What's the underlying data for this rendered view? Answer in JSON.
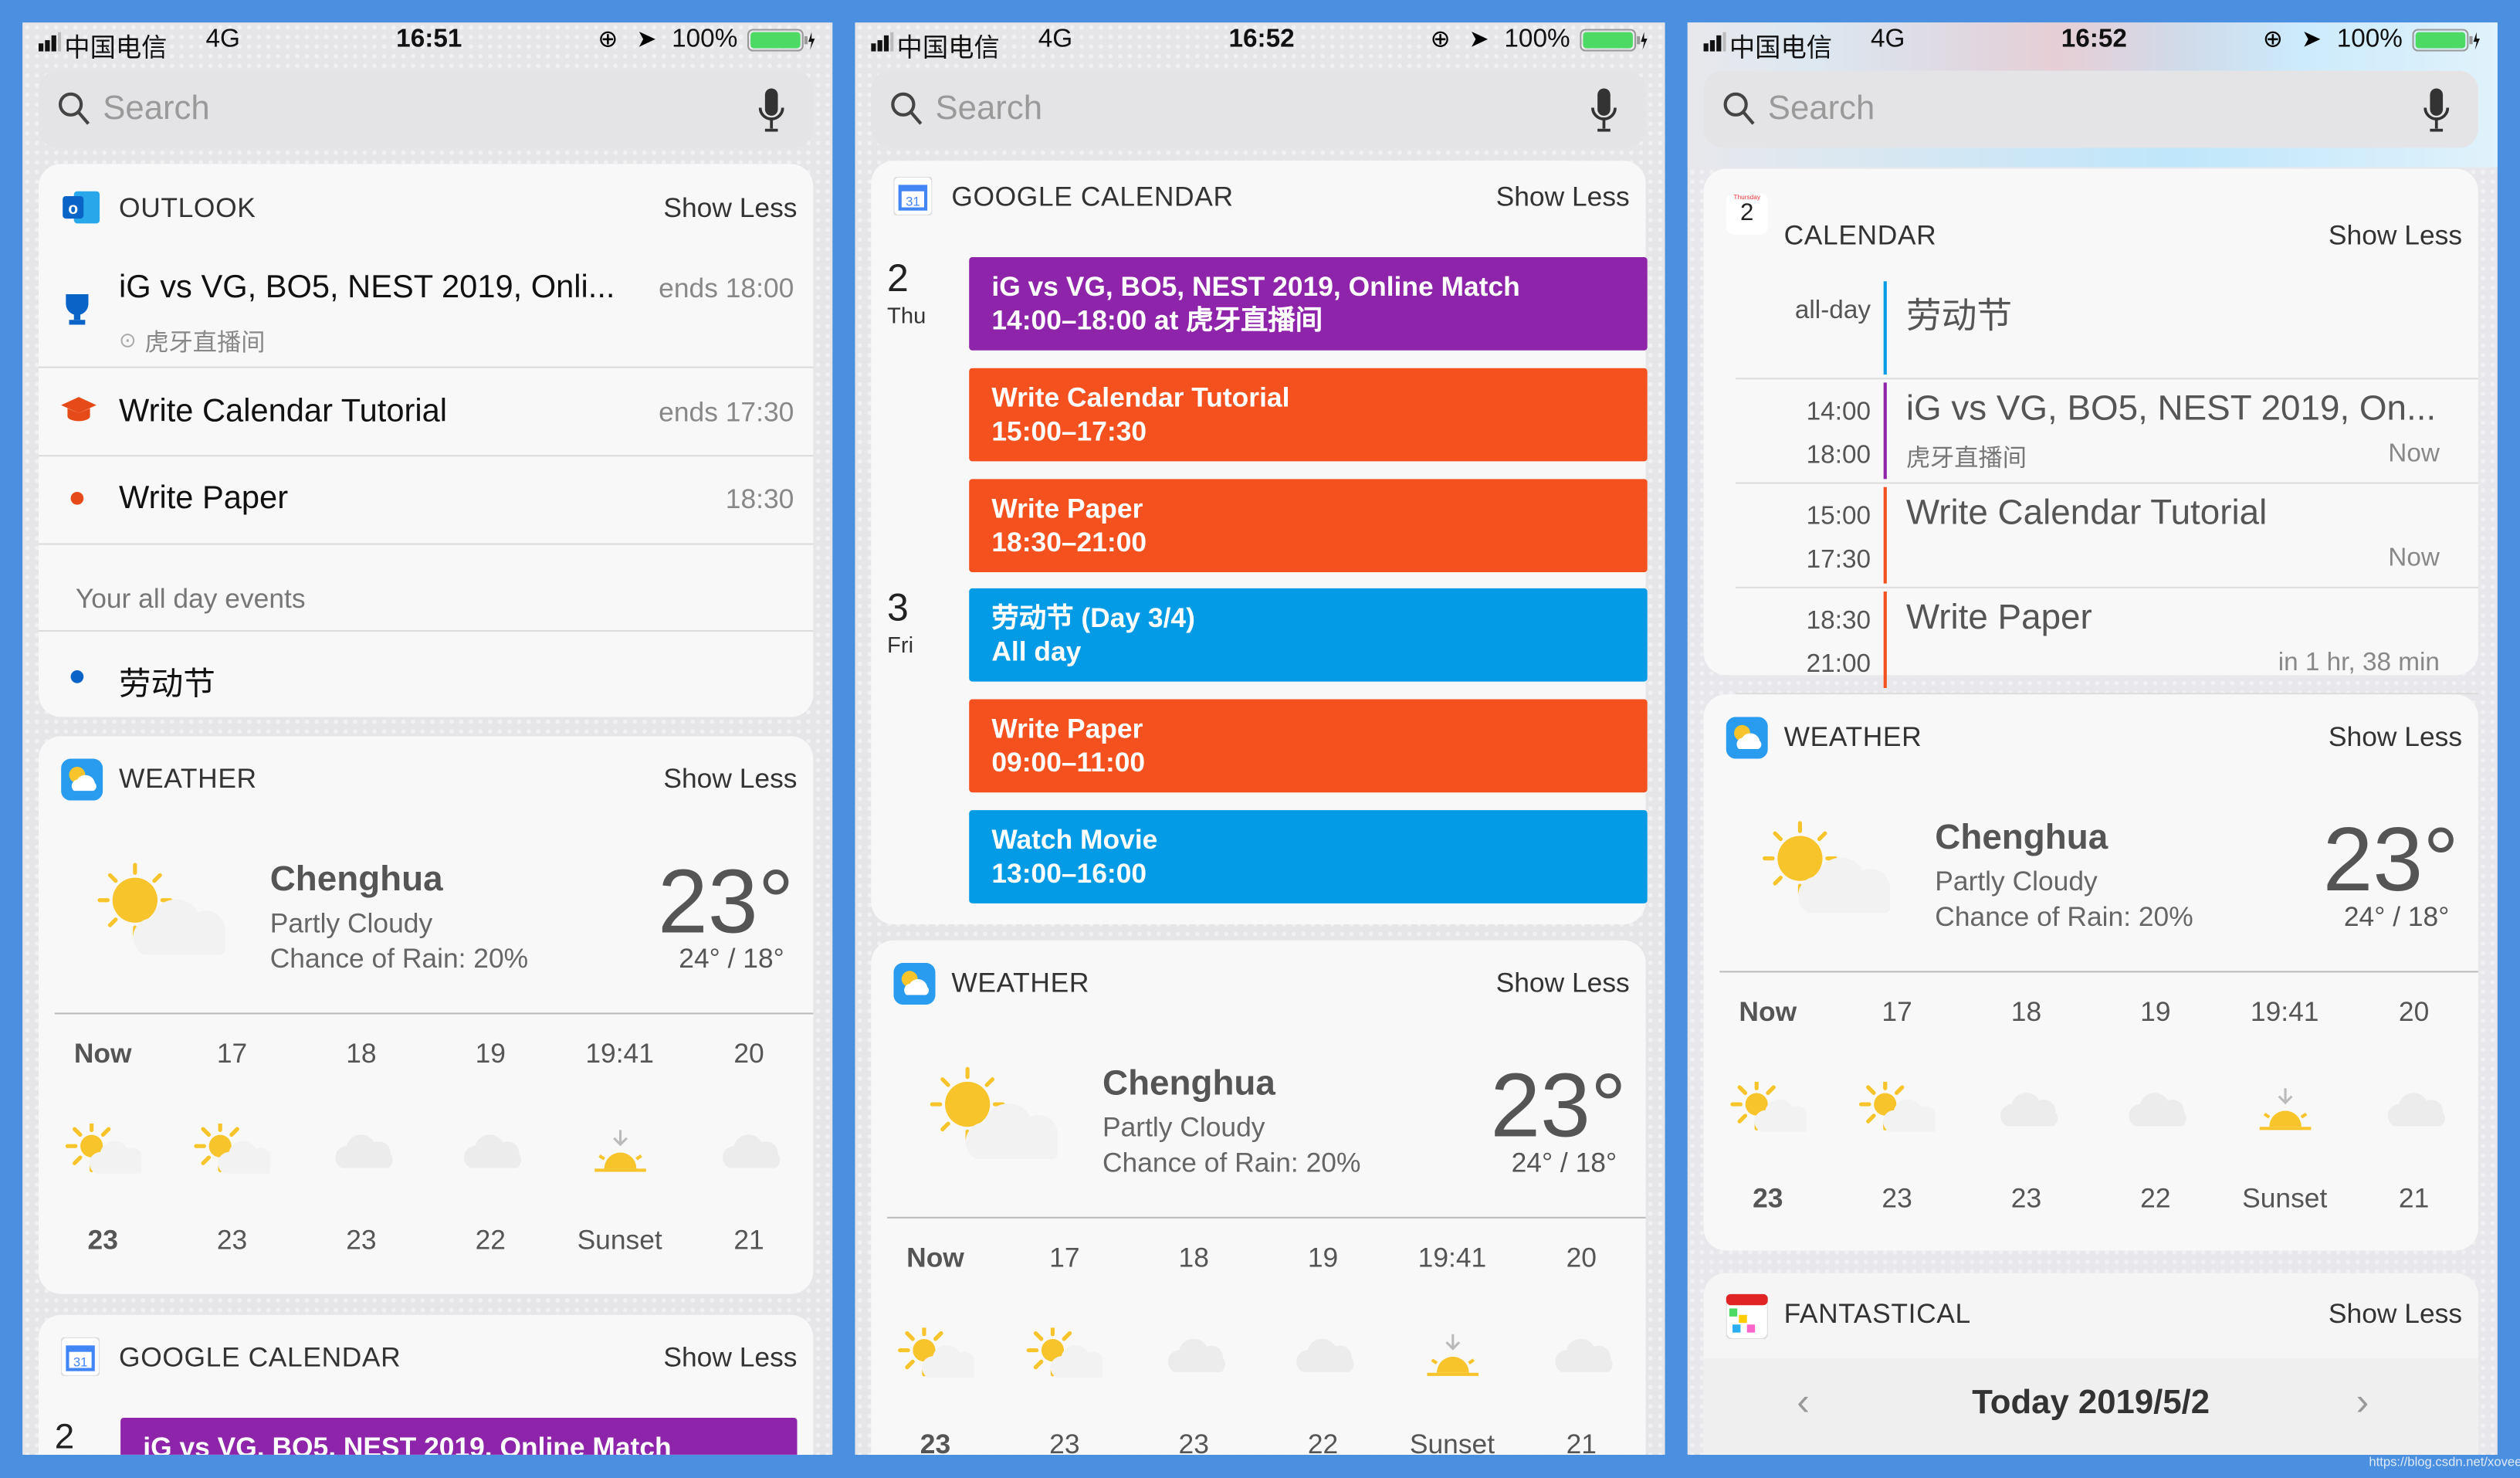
{
  "colors": {
    "background": "#4a8fe0",
    "purple": "#8e24aa",
    "orange": "#f4511e",
    "blue": "#039be5",
    "battery": "#4cd964"
  },
  "watermark": "https://blog.csdn.net/xovee",
  "panels": [
    {
      "status": {
        "carrier": "中国电信",
        "network": "4G",
        "time": "16:51",
        "battery": "100%"
      },
      "search": {
        "placeholder": "Search"
      },
      "outlook": {
        "title": "OUTLOOK",
        "show_less": "Show Less",
        "events": [
          {
            "title": "iG vs VG, BO5, NEST 2019, Onli...",
            "location": "虎牙直播间",
            "time": "ends 18:00",
            "icon": "trophy-icon"
          },
          {
            "title": "Write Calendar Tutorial",
            "time": "ends 17:30",
            "icon": "graduation-cap-icon"
          },
          {
            "title": "Write Paper",
            "time": "18:30",
            "icon": "dot-icon"
          }
        ],
        "all_day_label": "Your all day events",
        "all_day_events": [
          {
            "title": "劳动节"
          }
        ]
      },
      "weather": {
        "title": "WEATHER",
        "show_less": "Show Less",
        "city": "Chenghua",
        "condition": "Partly Cloudy",
        "rain": "Chance of Rain: 20%",
        "temp": "23°",
        "hilo": "24° / 18°",
        "hourly": [
          {
            "label": "Now",
            "icon": "sun-cloud",
            "temp": "23"
          },
          {
            "label": "17",
            "icon": "sun-cloud",
            "temp": "23"
          },
          {
            "label": "18",
            "icon": "cloud",
            "temp": "23"
          },
          {
            "label": "19",
            "icon": "cloud",
            "temp": "22"
          },
          {
            "label": "19:41",
            "icon": "sunset",
            "temp": "Sunset"
          },
          {
            "label": "20",
            "icon": "cloud",
            "temp": "21"
          }
        ]
      },
      "gcal": {
        "title": "GOOGLE CALENDAR",
        "show_less": "Show Less",
        "day": "2",
        "event": "iG vs VG, BO5, NEST 2019, Online Match"
      }
    },
    {
      "status": {
        "carrier": "中国电信",
        "network": "4G",
        "time": "16:52",
        "battery": "100%"
      },
      "search": {
        "placeholder": "Search"
      },
      "gcal": {
        "title": "GOOGLE CALENDAR",
        "show_less": "Show Less",
        "days": [
          {
            "day": "2",
            "weekday": "Thu"
          },
          {
            "day": "3",
            "weekday": "Fri"
          }
        ],
        "events": [
          {
            "title": "iG vs VG, BO5, NEST 2019, Online Match",
            "time": "14:00–18:00 at 虎牙直播间",
            "color": "#8e24aa"
          },
          {
            "title": "Write Calendar Tutorial",
            "time": "15:00–17:30",
            "color": "#f4511e"
          },
          {
            "title": "Write Paper",
            "time": "18:30–21:00",
            "color": "#f4511e"
          },
          {
            "title": "劳动节 (Day 3/4)",
            "time": "All day",
            "color": "#039be5"
          },
          {
            "title": "Write Paper",
            "time": "09:00–11:00",
            "color": "#f4511e"
          },
          {
            "title": "Watch Movie",
            "time": "13:00–16:00",
            "color": "#039be5"
          }
        ]
      },
      "weather": {
        "title": "WEATHER",
        "show_less": "Show Less",
        "city": "Chenghua",
        "condition": "Partly Cloudy",
        "rain": "Chance of Rain: 20%",
        "temp": "23°",
        "hilo": "24° / 18°",
        "hourly": [
          {
            "label": "Now",
            "icon": "sun-cloud",
            "temp": "23"
          },
          {
            "label": "17",
            "icon": "sun-cloud",
            "temp": "23"
          },
          {
            "label": "18",
            "icon": "cloud",
            "temp": "23"
          },
          {
            "label": "19",
            "icon": "cloud",
            "temp": "22"
          },
          {
            "label": "19:41",
            "icon": "sunset",
            "temp": "Sunset"
          },
          {
            "label": "20",
            "icon": "cloud",
            "temp": "21"
          }
        ]
      }
    },
    {
      "status": {
        "carrier": "中国电信",
        "network": "4G",
        "time": "16:52",
        "battery": "100%"
      },
      "search": {
        "placeholder": "Search"
      },
      "calendar": {
        "title": "CALENDAR",
        "show_less": "Show Less",
        "icon_weekday": "Thursday",
        "icon_day": "2",
        "all_day_label": "all-day",
        "all_day_title": "劳动节",
        "events": [
          {
            "start": "14:00",
            "end": "18:00",
            "title": "iG vs VG, BO5, NEST 2019, On...",
            "location": "虎牙直播间",
            "status": "Now",
            "color": "#8e24aa"
          },
          {
            "start": "15:00",
            "end": "17:30",
            "title": "Write Calendar Tutorial",
            "location": "",
            "status": "Now",
            "color": "#f4511e"
          },
          {
            "start": "18:30",
            "end": "21:00",
            "title": "Write Paper",
            "location": "",
            "status": "in 1 hr, 38 min",
            "color": "#f4511e"
          }
        ]
      },
      "weather": {
        "title": "WEATHER",
        "show_less": "Show Less",
        "city": "Chenghua",
        "condition": "Partly Cloudy",
        "rain": "Chance of Rain: 20%",
        "temp": "23°",
        "hilo": "24° / 18°",
        "hourly": [
          {
            "label": "Now",
            "icon": "sun-cloud",
            "temp": "23"
          },
          {
            "label": "17",
            "icon": "sun-cloud",
            "temp": "23"
          },
          {
            "label": "18",
            "icon": "cloud",
            "temp": "23"
          },
          {
            "label": "19",
            "icon": "cloud",
            "temp": "22"
          },
          {
            "label": "19:41",
            "icon": "sunset",
            "temp": "Sunset"
          },
          {
            "label": "20",
            "icon": "cloud",
            "temp": "21"
          }
        ]
      },
      "fantastical": {
        "title": "FANTASTICAL",
        "show_less": "Show Less",
        "date": "Today 2019/5/2"
      }
    }
  ]
}
